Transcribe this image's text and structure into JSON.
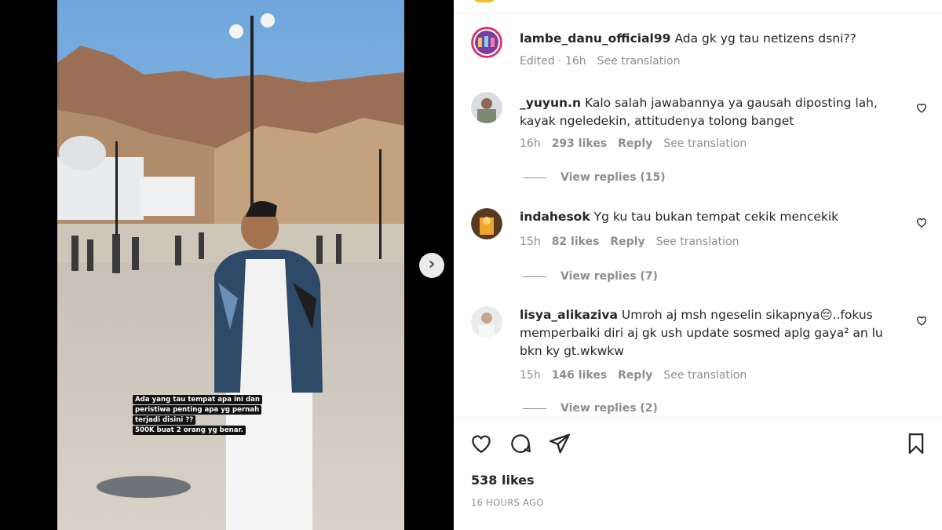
{
  "media": {
    "story_caption_lines": [
      "Ada yang tau tempat apa ini dan",
      "peristiwa penting apa yg pernah",
      "terjadi disini ??",
      "500K buat 2 orang yg benar."
    ],
    "next_icon": "chevron-right-icon"
  },
  "post": {
    "caption": {
      "username": "lambe_danu_official99",
      "text": "Ada gk yg tau netizens dsni??",
      "edited": "Edited · 16h",
      "see_translation": "See translation"
    },
    "comments": [
      {
        "username": "_yuyun.n",
        "text": "Kalo salah jawabannya ya gausah diposting lah, kayak ngeledekin, attitudenya tolong banget",
        "time": "16h",
        "likes": "293 likes",
        "reply": "Reply",
        "see_translation": "See translation",
        "view_replies": "View replies (15)"
      },
      {
        "username": "indahesok",
        "text": "Yg ku tau bukan tempat cekik mencekik",
        "time": "15h",
        "likes": "82 likes",
        "reply": "Reply",
        "see_translation": "See translation",
        "view_replies": "View replies (7)"
      },
      {
        "username": "lisya_alikaziva",
        "text": "Umroh aj msh ngeselin sikapnya😔..fokus memperbaiki diri aj gk ush update sosmed aplg gaya² an lu bkn ky gt.wkwkw",
        "time": "15h",
        "likes": "146 likes",
        "reply": "Reply",
        "see_translation": "See translation",
        "view_replies": "View replies (2)"
      }
    ],
    "likes": "538 likes",
    "timestamp": "16 HOURS AGO"
  },
  "icons": {
    "like": "heart-icon",
    "comment": "comment-icon",
    "share": "send-icon",
    "save": "bookmark-icon"
  },
  "colors": {
    "text": "#262626",
    "secondary": "#8e8e8e",
    "border": "#efefef"
  }
}
